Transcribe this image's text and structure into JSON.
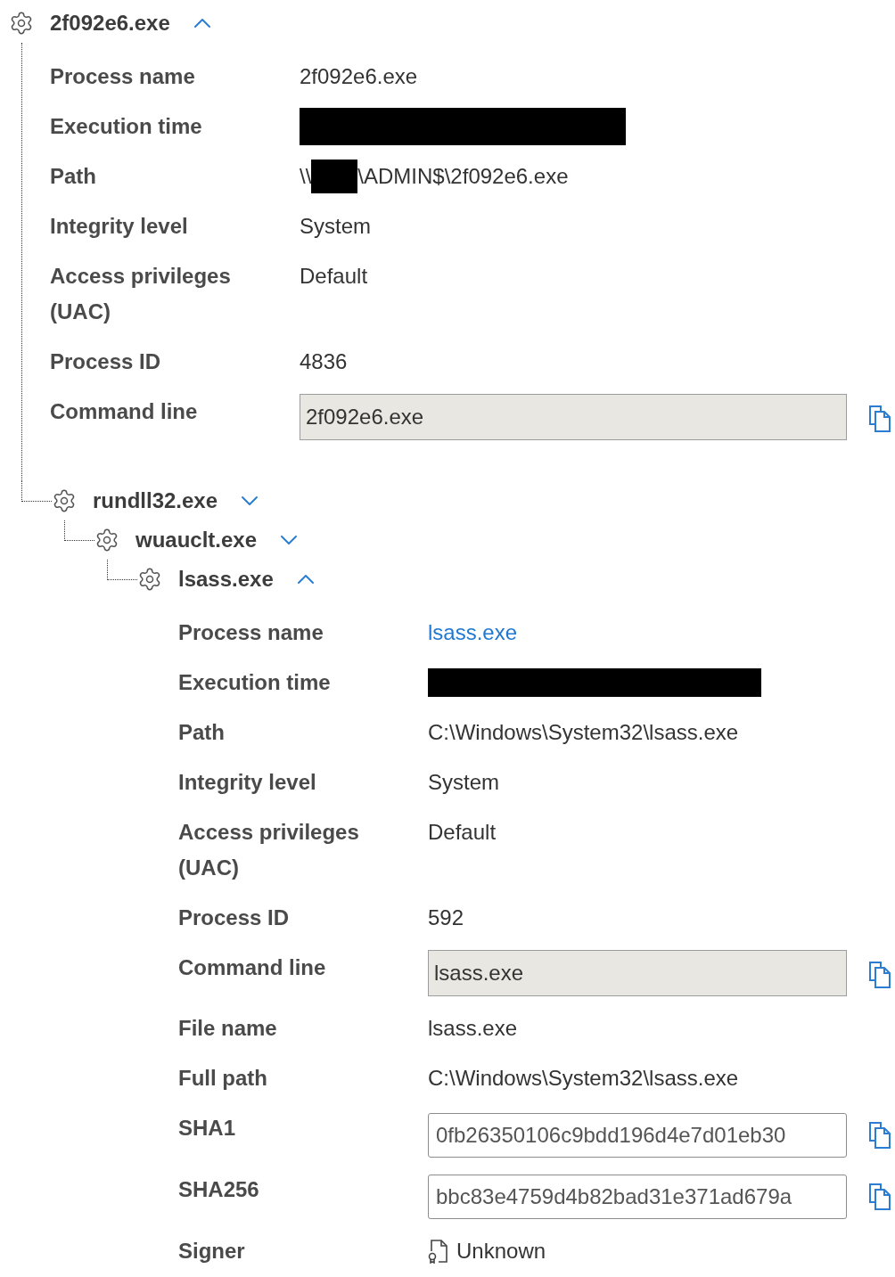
{
  "tree": [
    {
      "name": "2f092e6.exe",
      "expanded": true,
      "details": [
        {
          "kind": "text",
          "label": "Process name",
          "value": "2f092e6.exe"
        },
        {
          "kind": "redacted",
          "label": "Execution time"
        },
        {
          "kind": "redacted_path",
          "label": "Path",
          "prefix": "\\\\",
          "suffix": "\\ADMIN$\\2f092e6.exe"
        },
        {
          "kind": "text",
          "label": "Integrity level",
          "value": "System"
        },
        {
          "kind": "text",
          "label": "Access privileges (UAC)",
          "value": "Default"
        },
        {
          "kind": "text",
          "label": "Process ID",
          "value": "4836"
        },
        {
          "kind": "command",
          "label": "Command line",
          "value": "2f092e6.exe"
        }
      ],
      "children": [
        {
          "name": "rundll32.exe",
          "expanded": false,
          "children": [
            {
              "name": "wuauclt.exe",
              "expanded": false,
              "children": [
                {
                  "name": "lsass.exe",
                  "expanded": true,
                  "details": [
                    {
                      "kind": "link",
                      "label": "Process name",
                      "value": "lsass.exe"
                    },
                    {
                      "kind": "redacted",
                      "label": "Execution time"
                    },
                    {
                      "kind": "text",
                      "label": "Path",
                      "value": "C:\\Windows\\System32\\lsass.exe"
                    },
                    {
                      "kind": "text",
                      "label": "Integrity level",
                      "value": "System"
                    },
                    {
                      "kind": "text",
                      "label": "Access privileges (UAC)",
                      "value": "Default"
                    },
                    {
                      "kind": "text",
                      "label": "Process ID",
                      "value": "592"
                    },
                    {
                      "kind": "command",
                      "label": "Command line",
                      "value": "lsass.exe"
                    },
                    {
                      "kind": "text",
                      "label": "File name",
                      "value": "lsass.exe"
                    },
                    {
                      "kind": "text",
                      "label": "Full path",
                      "value": "C:\\Windows\\System32\\lsass.exe"
                    },
                    {
                      "kind": "hash",
                      "label": "SHA1",
                      "value": "0fb26350106c9bdd196d4e7d01eb30"
                    },
                    {
                      "kind": "hash",
                      "label": "SHA256",
                      "value": "bbc83e4759d4b82bad31e371ad679a"
                    },
                    {
                      "kind": "signer",
                      "label": "Signer",
                      "value": "Unknown"
                    }
                  ]
                }
              ]
            }
          ]
        }
      ]
    }
  ]
}
